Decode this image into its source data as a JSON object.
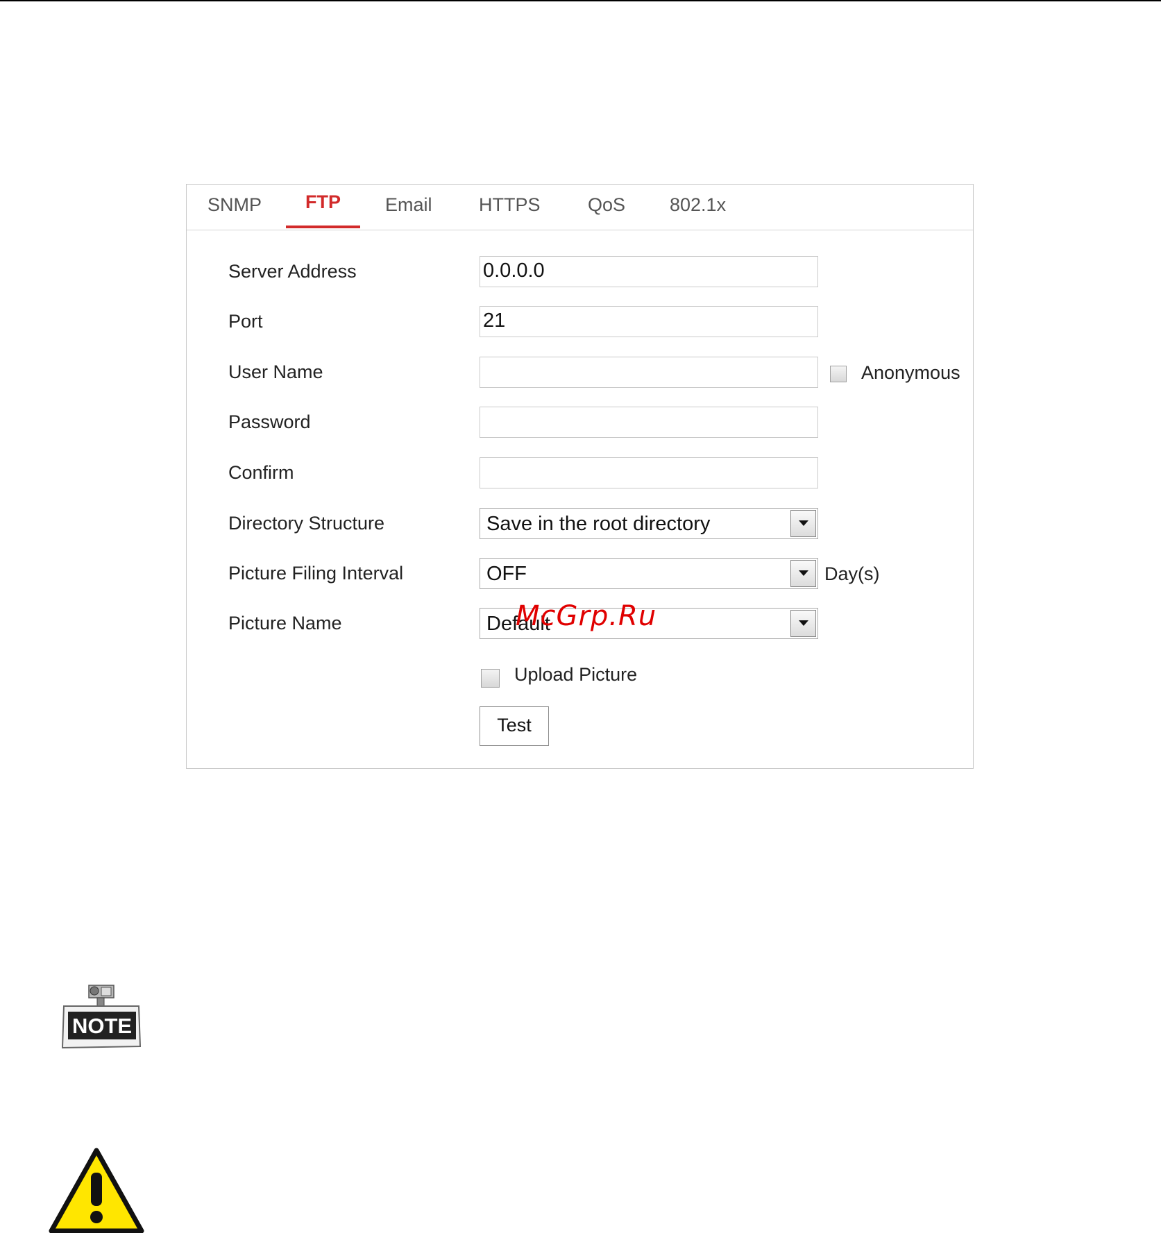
{
  "tabs": [
    {
      "label": "SNMP"
    },
    {
      "label": "FTP"
    },
    {
      "label": "Email"
    },
    {
      "label": "HTTPS"
    },
    {
      "label": "QoS"
    },
    {
      "label": "802.1x"
    }
  ],
  "active_tab": "FTP",
  "form": {
    "server_address": {
      "label": "Server Address",
      "value": "0.0.0.0"
    },
    "port": {
      "label": "Port",
      "value": "21"
    },
    "user_name": {
      "label": "User Name",
      "value": ""
    },
    "anonymous_label": "Anonymous",
    "password": {
      "label": "Password",
      "value": ""
    },
    "confirm": {
      "label": "Confirm",
      "value": ""
    },
    "directory_structure": {
      "label": "Directory Structure",
      "value": "Save in the root directory"
    },
    "picture_filing_interval": {
      "label": "Picture Filing Interval",
      "value": "OFF",
      "unit": "Day(s)"
    },
    "picture_name": {
      "label": "Picture Name",
      "value": "Default"
    },
    "upload_picture_label": "Upload Picture",
    "test_button": "Test"
  },
  "watermark": "McGrp.Ru",
  "note_icon_text": "NOTE",
  "colors": {
    "active_tab": "#d22a2a",
    "watermark": "#e00000",
    "warning_fill": "#ffe600"
  },
  "icons": [
    "note-icon",
    "warning-icon",
    "chevron-down-icon",
    "checkbox"
  ]
}
